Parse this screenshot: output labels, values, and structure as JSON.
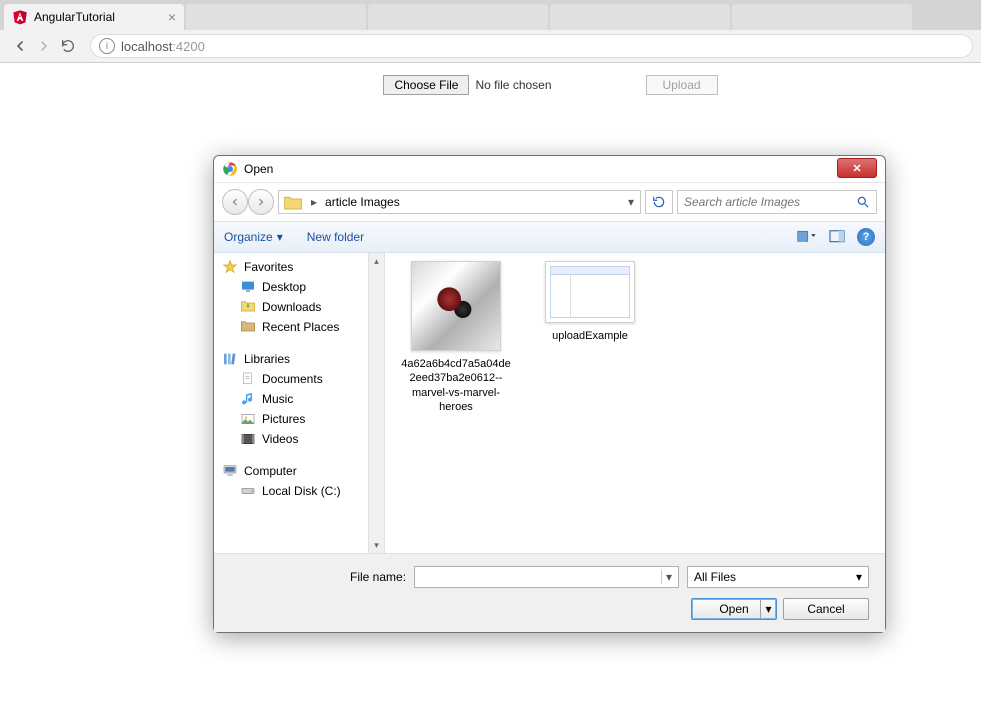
{
  "browser": {
    "active_tab": {
      "title": "AngularTutorial"
    },
    "url_host": "localhost",
    "url_port": ":4200",
    "nav_back": "←",
    "nav_forward": "→",
    "nav_reload": "↻"
  },
  "page": {
    "choose_file_label": "Choose File",
    "no_file_text": "No file chosen",
    "upload_label": "Upload"
  },
  "dialog": {
    "title": "Open",
    "breadcrumb": {
      "folder": "article Images"
    },
    "search_placeholder": "Search article Images",
    "toolbar": {
      "organize": "Organize",
      "new_folder": "New folder"
    },
    "sidebar": {
      "favorites_label": "Favorites",
      "favorites": [
        {
          "label": "Desktop",
          "icon": "desktop"
        },
        {
          "label": "Downloads",
          "icon": "downloads"
        },
        {
          "label": "Recent Places",
          "icon": "recent"
        }
      ],
      "libraries_label": "Libraries",
      "libraries": [
        {
          "label": "Documents",
          "icon": "documents"
        },
        {
          "label": "Music",
          "icon": "music"
        },
        {
          "label": "Pictures",
          "icon": "pictures"
        },
        {
          "label": "Videos",
          "icon": "videos"
        }
      ],
      "computer_label": "Computer",
      "computer": [
        {
          "label": "Local Disk (C:)",
          "icon": "disk"
        }
      ]
    },
    "files": [
      {
        "name": "4a62a6b4cd7a5a04de2eed37ba2e0612--marvel-vs-marvel-heroes"
      },
      {
        "name": "uploadExample"
      }
    ],
    "footer": {
      "filename_label": "File name:",
      "filename_value": "",
      "filter": "All Files",
      "open_label": "Open",
      "cancel_label": "Cancel"
    }
  }
}
